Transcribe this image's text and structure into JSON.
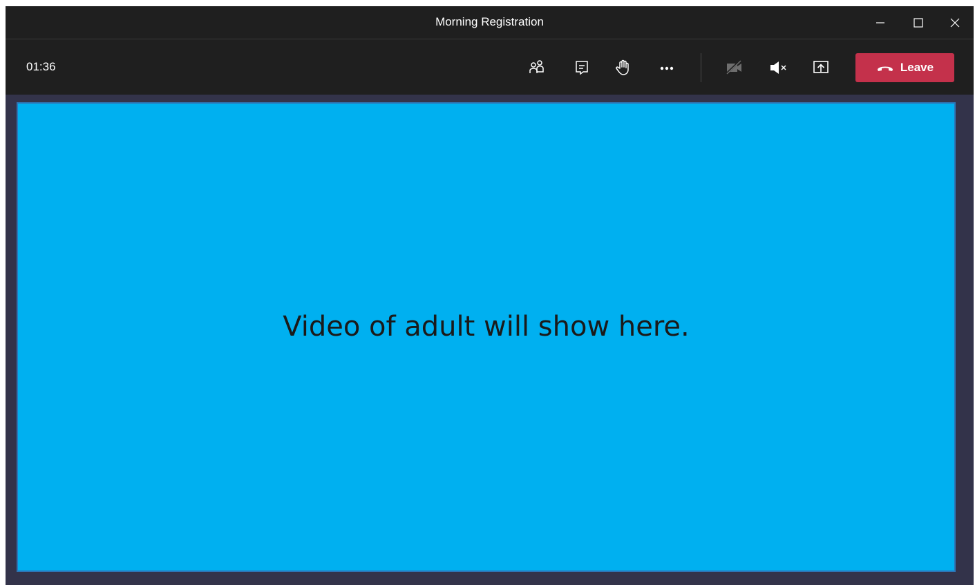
{
  "window": {
    "title": "Morning Registration",
    "controls": {
      "minimize_icon": "minimize-icon",
      "maximize_icon": "maximize-icon",
      "close_icon": "close-icon"
    }
  },
  "toolbar": {
    "timer": "01:36",
    "icons": [
      "people-icon",
      "chat-icon",
      "raise-hand-icon",
      "more-options-icon",
      "camera-off-icon",
      "speaker-muted-icon",
      "share-screen-icon"
    ],
    "leave_label": "Leave",
    "leave_icon": "hang-up-icon"
  },
  "stage": {
    "placeholder": "Video of adult will show here."
  },
  "colors": {
    "titlebar": "#1f1f1f",
    "background": "#33334a",
    "leave": "#c4314b",
    "stage": "#00b0f0",
    "stage_border": "#2e75b6"
  }
}
